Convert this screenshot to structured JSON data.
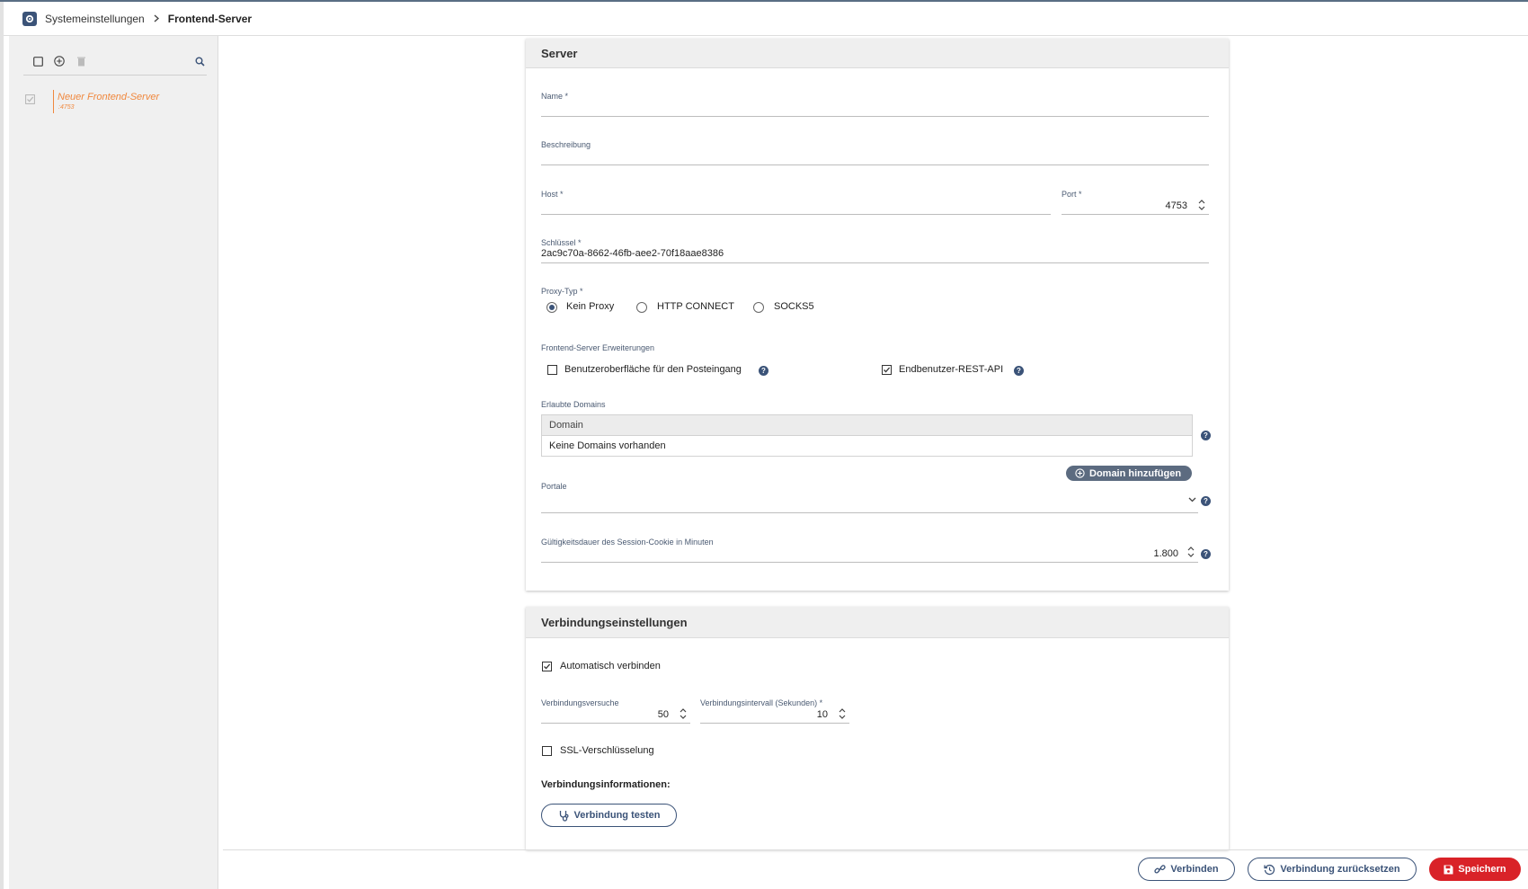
{
  "breadcrumb": {
    "root": "Systemeinstellungen",
    "current": "Frontend-Server"
  },
  "sidebar": {
    "items": [
      {
        "name": "Neuer Frontend-Server",
        "sub": ":4753"
      }
    ]
  },
  "server_card": {
    "title": "Server",
    "name": {
      "label": "Name *",
      "value": ""
    },
    "description": {
      "label": "Beschreibung",
      "value": ""
    },
    "host": {
      "label": "Host *",
      "value": ""
    },
    "port": {
      "label": "Port *",
      "value": "4753"
    },
    "key": {
      "label": "Schlüssel *",
      "value": "2ac9c70a-8662-46fb-aee2-70f18aae8386"
    },
    "proxy": {
      "label": "Proxy-Typ *",
      "options": [
        "Kein Proxy",
        "HTTP CONNECT",
        "SOCKS5"
      ],
      "selected": "Kein Proxy"
    },
    "extensions": {
      "label": "Frontend-Server Erweiterungen",
      "inbox_ui": {
        "label": "Benutzeroberfläche für den Posteingang",
        "checked": false
      },
      "rest_api": {
        "label": "Endbenutzer-REST-API",
        "checked": true
      }
    },
    "domains": {
      "label": "Erlaubte Domains",
      "column": "Domain",
      "empty": "Keine Domains vorhanden",
      "add_button": "Domain hinzufügen"
    },
    "portals": {
      "label": "Portale",
      "value": ""
    },
    "session": {
      "label": "Gültigkeitsdauer des Session-Cookie in Minuten",
      "value": "1.800"
    }
  },
  "connection_card": {
    "title": "Verbindungseinstellungen",
    "auto_connect": {
      "label": "Automatisch verbinden",
      "checked": true
    },
    "attempts": {
      "label": "Verbindungsversuche",
      "value": "50"
    },
    "interval": {
      "label": "Verbindungsintervall (Sekunden) *",
      "value": "10"
    },
    "ssl": {
      "label": "SSL-Verschlüsselung",
      "checked": false
    },
    "info_heading": "Verbindungsinformationen:",
    "test_button": "Verbindung testen"
  },
  "footer": {
    "connect": "Verbinden",
    "reset": "Verbindung zurücksetzen",
    "save": "Speichern"
  },
  "colors": {
    "accent": "#3b5378",
    "orange": "#f0883e",
    "danger": "#d92228"
  }
}
